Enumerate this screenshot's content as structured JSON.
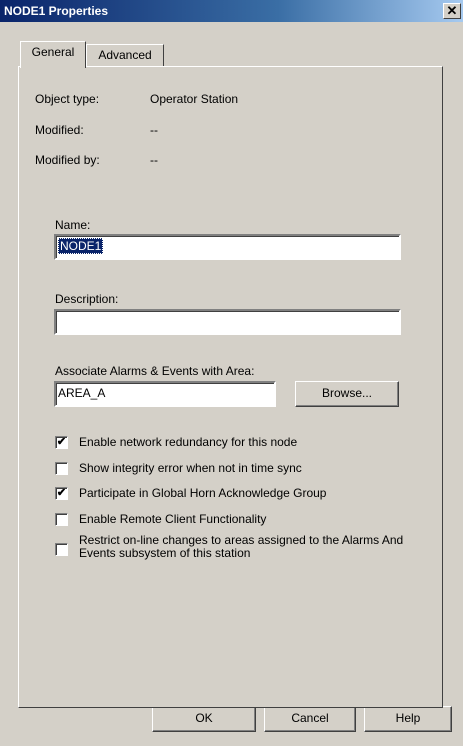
{
  "window": {
    "title": "NODE1 Properties",
    "close_glyph": "✕"
  },
  "tabs": [
    {
      "label": "General",
      "selected": true
    },
    {
      "label": "Advanced",
      "selected": false
    }
  ],
  "info": {
    "object_type_label": "Object type:",
    "object_type_value": "Operator Station",
    "modified_label": "Modified:",
    "modified_value": "--",
    "modified_by_label": "Modified by:",
    "modified_by_value": "--"
  },
  "name": {
    "label": "Name:",
    "value": "NODE1"
  },
  "description": {
    "label": "Description:",
    "value": ""
  },
  "area": {
    "label": "Associate Alarms & Events with Area:",
    "value": "AREA_A",
    "browse_label": "Browse..."
  },
  "checkboxes": [
    {
      "label": "Enable network redundancy for this node",
      "checked": true
    },
    {
      "label": "Show integrity error when not in time sync",
      "checked": false
    },
    {
      "label": "Participate in Global Horn Acknowledge Group",
      "checked": true
    },
    {
      "label": "Enable Remote Client Functionality",
      "checked": false
    },
    {
      "label": "Restrict on-line changes to areas assigned to the Alarms And Events subsystem of this station",
      "checked": false
    }
  ],
  "footer": {
    "ok_label": "OK",
    "cancel_label": "Cancel",
    "help_label": "Help"
  },
  "icons": {
    "check_glyph": "✔"
  }
}
